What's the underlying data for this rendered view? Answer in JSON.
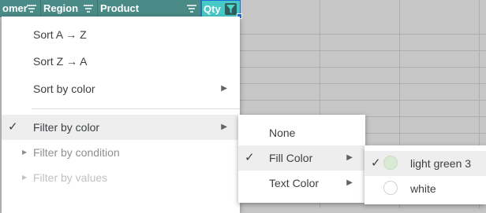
{
  "columns": [
    {
      "label": "omer"
    },
    {
      "label": "Region"
    },
    {
      "label": "Product"
    },
    {
      "label": "Qty"
    }
  ],
  "colors": {
    "header_bg": "#4a8a87",
    "active_header_bg": "#47c9c8",
    "light_green_3": "#d9ead3",
    "white": "#ffffff",
    "selection_blue": "#1f6cd8"
  },
  "main_menu": {
    "sort_az": "Sort A → Z",
    "sort_za": "Sort Z → A",
    "sort_by_color": "Sort by color",
    "filter_by_color": "Filter by color",
    "filter_by_condition": "Filter by condition",
    "filter_by_values": "Filter by values"
  },
  "color_menu": {
    "none": "None",
    "fill_color": "Fill Color",
    "text_color": "Text Color"
  },
  "fill_menu": {
    "options": [
      {
        "label": "light green 3",
        "checked": true
      },
      {
        "label": "white",
        "checked": false
      }
    ]
  },
  "icons": {
    "check": "✓",
    "submenu_arrow": "▶",
    "expand_arrow": "▶",
    "filter": "filter-lines-icon"
  }
}
